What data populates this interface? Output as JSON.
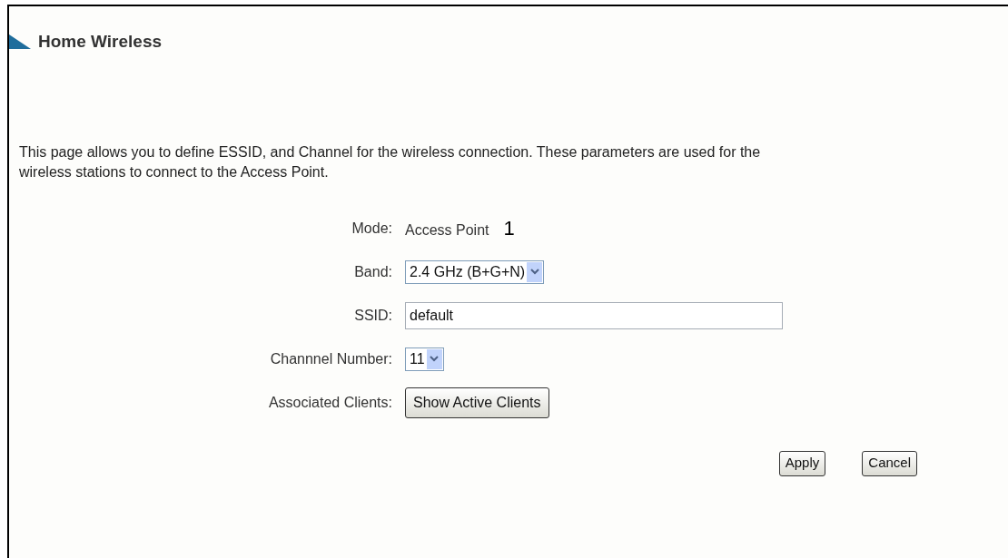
{
  "title": "Home Wireless",
  "description": "This page allows you to define ESSID, and Channel for the wireless connection. These parameters are used for the wireless stations to connect to the Access Point.",
  "fields": [
    {
      "kind": "text",
      "label": "Mode:",
      "value": "Access Point",
      "callout": "1"
    },
    {
      "kind": "select",
      "label": "Band:",
      "value": "2.4 GHz (B+G+N)"
    },
    {
      "kind": "input",
      "label": "SSID:",
      "value": "default"
    },
    {
      "kind": "select",
      "label": "Channnel Number:",
      "value": "11"
    },
    {
      "kind": "button",
      "label": "Associated Clients:",
      "value": "Show Active Clients"
    }
  ],
  "buttons": [
    "Apply",
    "Cancel"
  ]
}
